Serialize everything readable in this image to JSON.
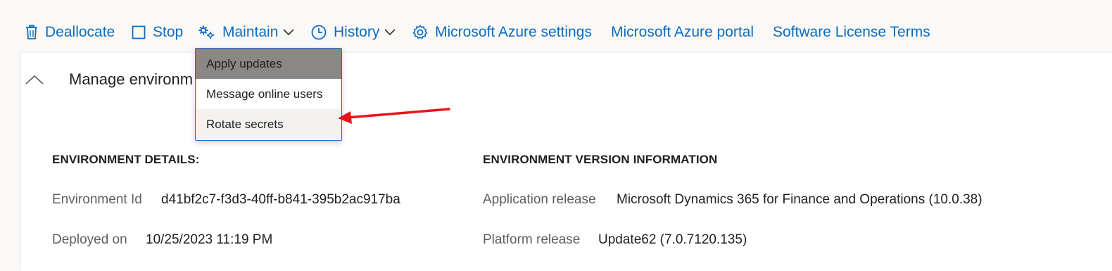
{
  "toolbar": {
    "deallocate": "Deallocate",
    "stop": "Stop",
    "maintain": "Maintain",
    "history": "History",
    "azure_settings": "Microsoft Azure settings",
    "azure_portal": "Microsoft Azure portal",
    "license_terms": "Software License Terms"
  },
  "maintain_menu": {
    "items": [
      "Apply updates",
      "Message online users",
      "Rotate secrets"
    ],
    "selected": "Apply updates"
  },
  "section": {
    "title": "Manage environm"
  },
  "environment_details": {
    "heading": "ENVIRONMENT DETAILS:",
    "environment_id_label": "Environment Id",
    "environment_id_value": "d41bf2c7-f3d3-40ff-b841-395b2ac917ba",
    "deployed_on_label": "Deployed on",
    "deployed_on_value": "10/25/2023 11:19 PM"
  },
  "version_info": {
    "heading": "ENVIRONMENT VERSION INFORMATION",
    "application_release_label": "Application release",
    "application_release_value": "Microsoft Dynamics 365 for Finance and Operations (10.0.38)",
    "platform_release_label": "Platform release",
    "platform_release_value": "Update62 (7.0.7120.135)"
  },
  "colors": {
    "link": "#0f6cbd",
    "annotation_arrow": "#e8141b",
    "menu_border": "#2266cc",
    "selected_item": "#8a8886"
  },
  "icons": {
    "deallocate": "trash-icon",
    "stop": "stop-icon",
    "maintain": "gears-icon",
    "history": "clock-icon",
    "azure_settings": "gear-icon"
  }
}
